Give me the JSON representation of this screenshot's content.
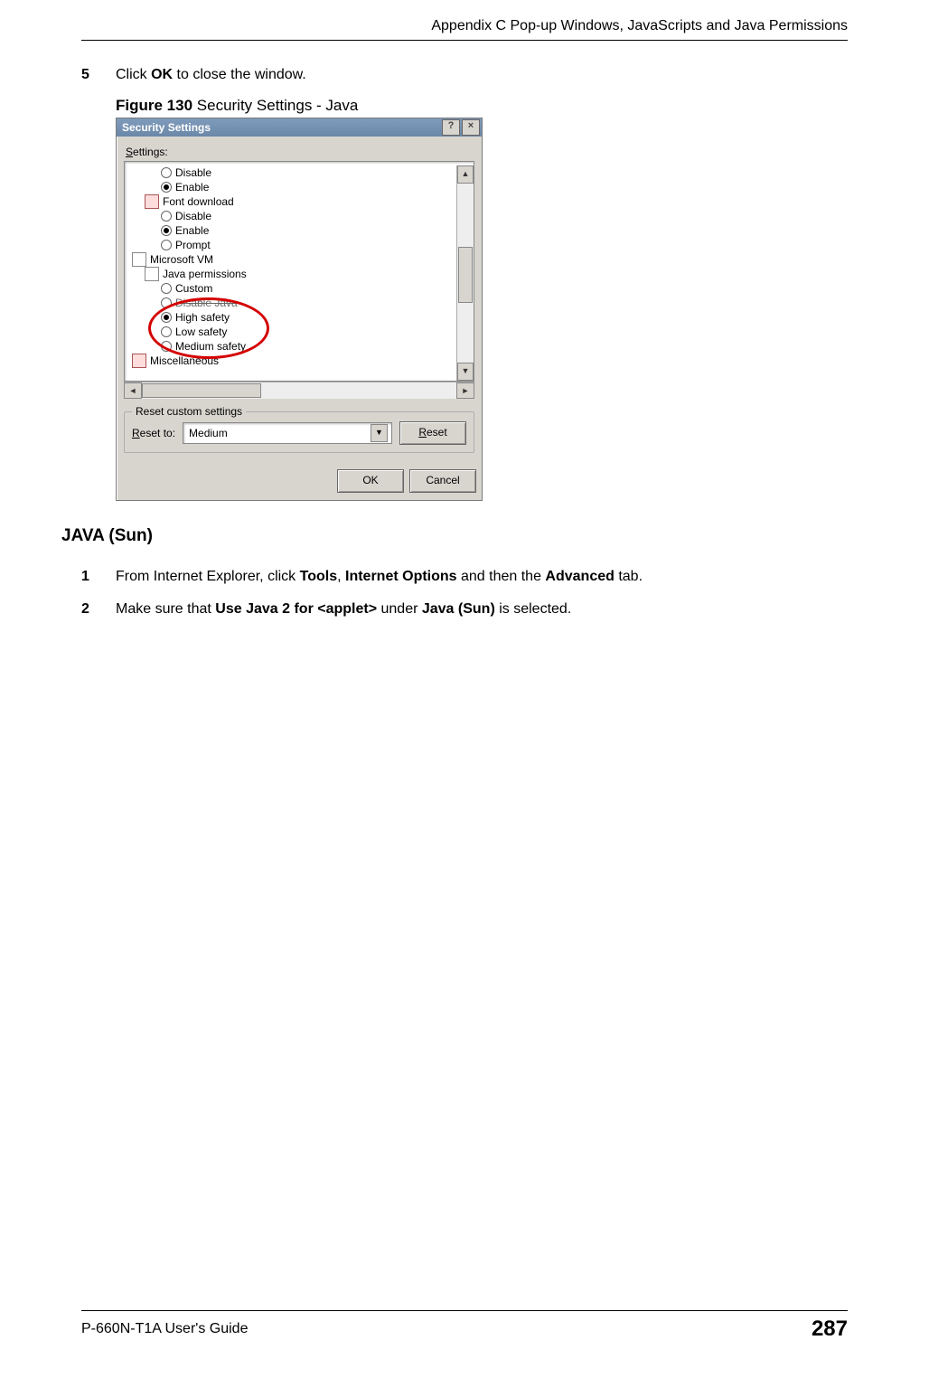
{
  "header": {
    "title": "Appendix C Pop-up Windows, JavaScripts and Java Permissions"
  },
  "step5": {
    "num": "5",
    "pre": "Click ",
    "bold": "OK",
    "post": " to close the window."
  },
  "figure": {
    "label": "Figure 130",
    "caption": "   Security Settings - Java"
  },
  "dialog": {
    "title": "Security Settings",
    "help": "?",
    "close": "×",
    "settings_label_prefix": "S",
    "settings_label_rest": "ettings:",
    "tree": {
      "disable1": "Disable",
      "enable1": "Enable",
      "font_download": "Font download",
      "disable2": "Disable",
      "enable2": "Enable",
      "prompt": "Prompt",
      "msvm": "Microsoft VM",
      "java_perm": "Java permissions",
      "custom": "Custom",
      "disable_java": "Disable Java",
      "high_safety": "High safety",
      "low_safety": "Low safety",
      "medium_safety": "Medium safety",
      "misc": "Miscellaneous"
    },
    "legend": "Reset custom settings",
    "reset_to_prefix": "R",
    "reset_to_rest": "eset to:",
    "combo_value": "Medium",
    "reset_btn_prefix": "R",
    "reset_btn_rest": "eset",
    "ok": "OK",
    "cancel": "Cancel"
  },
  "section": {
    "heading": "JAVA (Sun)"
  },
  "step1": {
    "num": "1",
    "s1": "From Internet Explorer, click ",
    "b1": "Tools",
    "s2": ", ",
    "b2": "Internet Options",
    "s3": " and then the ",
    "b3": "Advanced",
    "s4": " tab."
  },
  "step2": {
    "num": "2",
    "s1": "Make sure that ",
    "b1": "Use Java 2 for <applet>",
    "s2": " under ",
    "b2": "Java (Sun)",
    "s3": " is selected."
  },
  "footer": {
    "guide": "P-660N-T1A User's Guide",
    "page": "287"
  }
}
